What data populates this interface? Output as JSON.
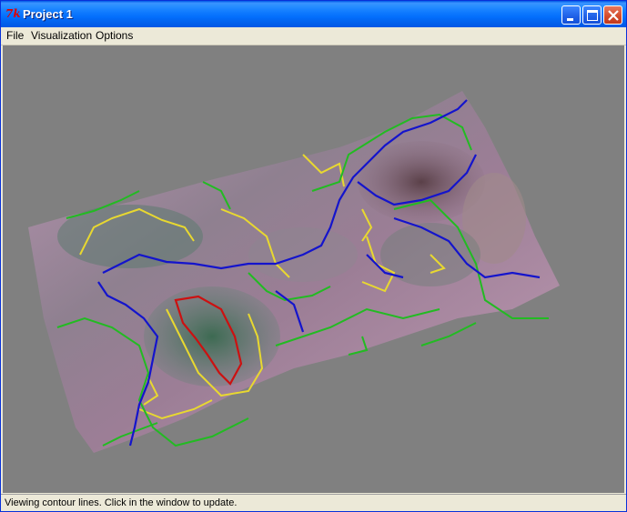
{
  "window": {
    "title": "Project 1",
    "app_icon_glyph": "7k",
    "controls": [
      "minimize-icon",
      "maximize-icon",
      "close-icon"
    ]
  },
  "menu": {
    "items": [
      {
        "label": "File"
      },
      {
        "label": "Visualization"
      },
      {
        "label": "Options"
      }
    ]
  },
  "viewport": {
    "background_color": "#808080",
    "terrain_colors": [
      "#b08ea8",
      "#7d8a7a",
      "#5a7a66",
      "#4a4040"
    ],
    "contour_colors": {
      "red": "#cc1111",
      "yellow": "#e8d830",
      "green": "#22bb22",
      "blue": "#1414cc"
    }
  },
  "status": {
    "text": "Viewing contour lines. Click in the window to update."
  }
}
